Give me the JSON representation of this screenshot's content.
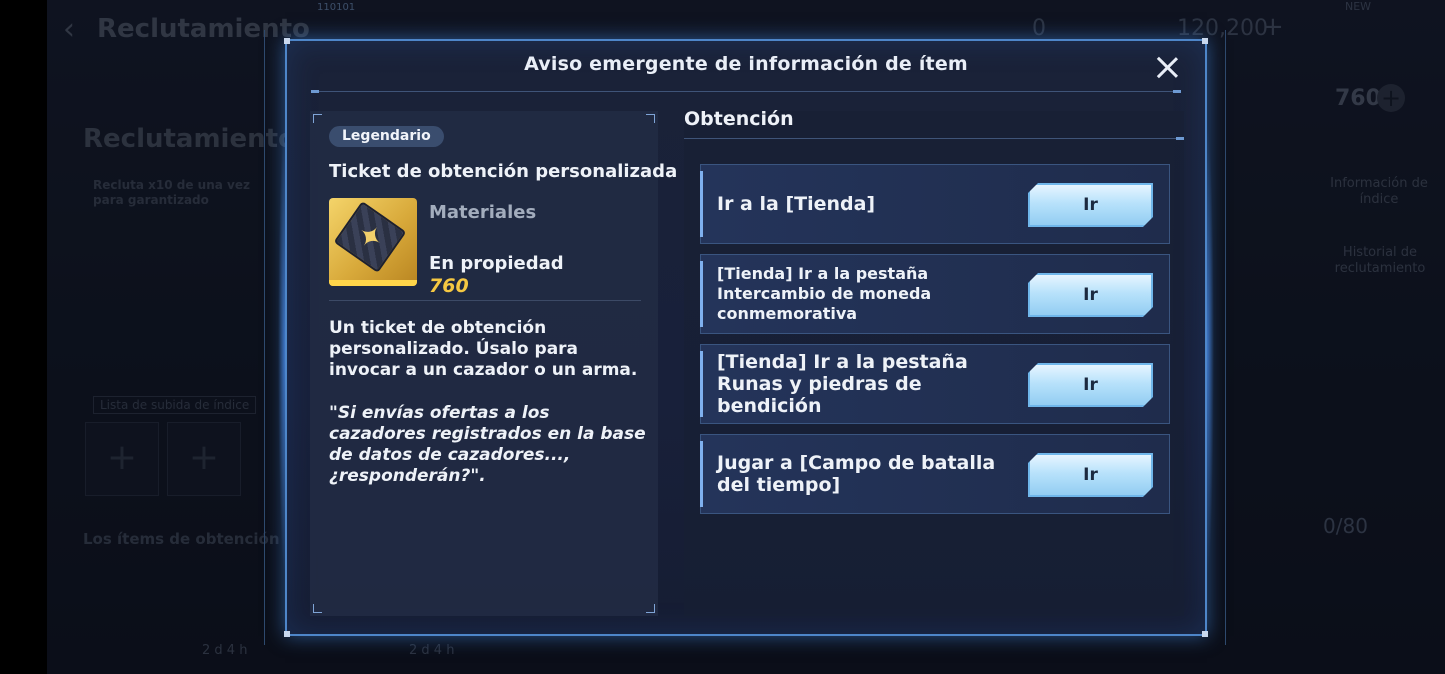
{
  "background": {
    "id_tag": "110101",
    "top_title": "Reclutamiento",
    "currency_a": "0",
    "currency_b": "120,200",
    "new_badge": "NEW",
    "tickets": "760",
    "section_title": "Reclutamiento",
    "note": "Recluta x10 de una vez para garantizado",
    "side_info": "Información de índice",
    "side_history": "Historial de reclutamiento",
    "list_label": "Lista de subida de índice",
    "items_label": "Los ítems de obtención po",
    "progress": "0/80",
    "timer_1": "2 d 4 h",
    "timer_2": "2 d 4 h"
  },
  "modal": {
    "title": "Aviso emergente de información de ítem",
    "item": {
      "rarity": "Legendario",
      "name": "Ticket de obtención personalizada",
      "category": "Materiales",
      "owned_label": "En propiedad",
      "owned_value": "760",
      "description": "Un ticket de obtención personalizado. Úsalo para invocar a un cazador o un arma.",
      "quote": "\"Si envías ofertas a los cazadores registrados en la base de datos de cazadores..., ¿responderán?\"."
    },
    "obtain": {
      "title": "Obtención",
      "rows": [
        {
          "text": "Ir a la [Tienda]",
          "button": "Ir"
        },
        {
          "text": "[Tienda] Ir a la pestaña Intercambio de moneda conmemorativa",
          "button": "Ir"
        },
        {
          "text": "[Tienda] Ir a la pestaña Runas y piedras de bendición",
          "button": "Ir"
        },
        {
          "text": "Jugar a [Campo de batalla del tiempo]",
          "button": "Ir"
        }
      ]
    }
  },
  "colors": {
    "accent": "#4e86c9",
    "gold": "#f5c842",
    "button": "#b8e2fb"
  }
}
